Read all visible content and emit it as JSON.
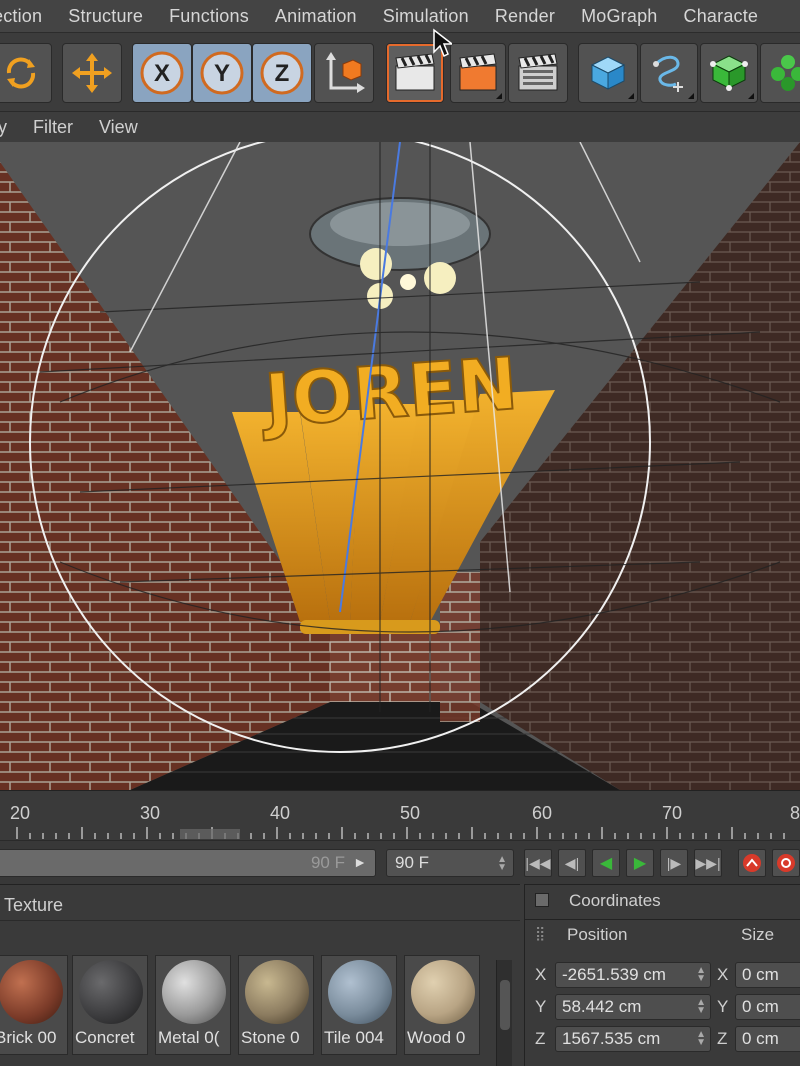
{
  "menu": [
    "ection",
    "Structure",
    "Functions",
    "Animation",
    "Simulation",
    "Render",
    "MoGraph",
    "Characte"
  ],
  "view_menu": [
    "y",
    "Filter",
    "View"
  ],
  "toolbar": {
    "axis_x": "X",
    "axis_y": "Y",
    "axis_z": "Z"
  },
  "viewport": {
    "title_text": "JOREN"
  },
  "timeline": {
    "ticks": [
      "20",
      "30",
      "40",
      "50",
      "60",
      "70",
      "8"
    ],
    "end_frame_field": "90 F",
    "end_frame_select": "90 F"
  },
  "materials": {
    "title": "Texture",
    "items": [
      {
        "label": "Brick 00",
        "color": "#7a3a28"
      },
      {
        "label": "Concret",
        "color": "#3a3a3c"
      },
      {
        "label": "Metal 0(",
        "color": "#9a9a9a"
      },
      {
        "label": "Stone 0",
        "color": "#8c7c60"
      },
      {
        "label": "Tile 004",
        "color": "#7a8c9c"
      },
      {
        "label": "Wood 0",
        "color": "#b8a484"
      }
    ]
  },
  "coordinates": {
    "title": "Coordinates",
    "position_label": "Position",
    "size_label": "Size",
    "rows": [
      {
        "axis": "X",
        "position": "-2651.539 cm",
        "size_axis": "X",
        "size": "0 cm"
      },
      {
        "axis": "Y",
        "position": "58.442 cm",
        "size_axis": "Y",
        "size": "0 cm"
      },
      {
        "axis": "Z",
        "position": "1567.535 cm",
        "size_axis": "Z",
        "size": "0 cm"
      }
    ]
  },
  "colors": {
    "accent_orange": "#e66a2c",
    "axis_blue": "#8aa4c0",
    "text_3d": "#e8a521"
  }
}
